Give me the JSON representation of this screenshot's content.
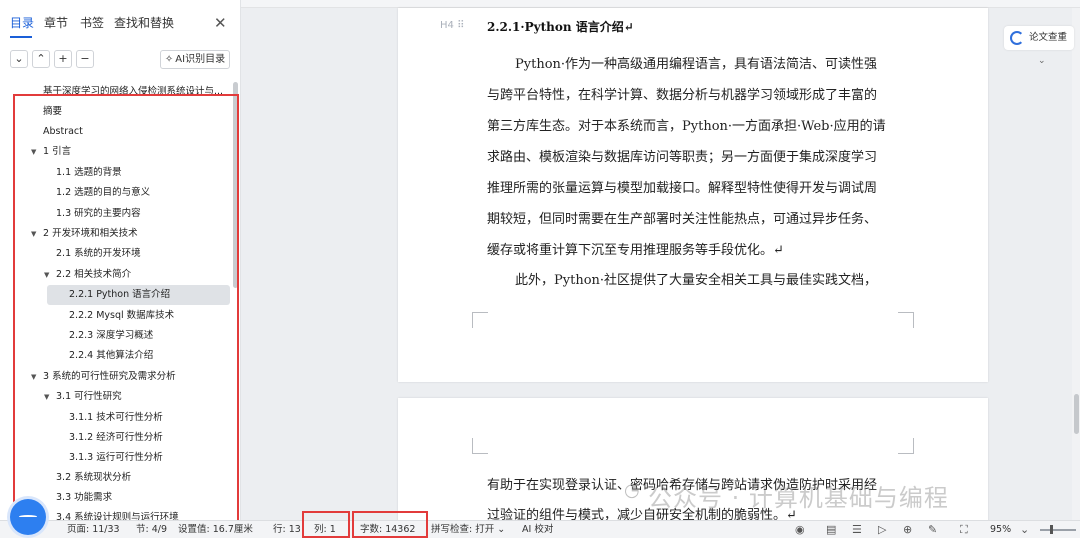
{
  "nav": {
    "tabs": [
      {
        "label": "目录"
      },
      {
        "label": "章节"
      },
      {
        "label": "书签"
      },
      {
        "label": "查找和替换"
      }
    ],
    "close_symbol": "✕",
    "tools": {
      "collapse": "⌄",
      "expand": "⌃",
      "add": "+",
      "remove": "−",
      "ai_toc_label": "AI识别目录"
    },
    "toc": [
      {
        "label": "基于深度学习的网络入侵检测系统设计与..."
      },
      {
        "label": "摘要"
      },
      {
        "label": "Abstract"
      },
      {
        "label": "1  引言"
      },
      {
        "label": "1.1 选题的背景"
      },
      {
        "label": "1.2 选题的目的与意义"
      },
      {
        "label": "1.3 研究的主要内容"
      },
      {
        "label": "2  开发环境和相关技术"
      },
      {
        "label": "2.1 系统的开发环境"
      },
      {
        "label": "2.2 相关技术简介"
      },
      {
        "label": "2.2.1 Python 语言介绍"
      },
      {
        "label": "2.2.2 Mysql 数据库技术"
      },
      {
        "label": "2.2.3  深度学习概述"
      },
      {
        "label": "2.2.4  其他算法介绍"
      },
      {
        "label": "3 系统的可行性研究及需求分析"
      },
      {
        "label": "3.1 可行性研究"
      },
      {
        "label": "3.1.1 技术可行性分析"
      },
      {
        "label": "3.1.2 经济可行性分析"
      },
      {
        "label": "3.1.3 运行可行性分析"
      },
      {
        "label": "3.2  系统现状分析"
      },
      {
        "label": "3.3 功能需求"
      },
      {
        "label": "3.4 系统设计规则与运行环境"
      }
    ]
  },
  "document": {
    "heading_tag": "H4",
    "heading": "2.2.1·Python 语言介绍↵",
    "page1_lines": [
      "Python·作为一种高级通用编程语言，具有语法简洁、可读性强",
      "与跨平台特性，在科学计算、数据分析与机器学习领域形成了丰富的",
      "第三方库生态。对于本系统而言，Python·一方面承担·Web·应用的请",
      "求路由、模板渲染与数据库访问等职责；另一方面便于集成深度学习",
      "推理所需的张量运算与模型加载接口。解释型特性使得开发与调试周",
      "期较短，但同时需要在生产部署时关注性能热点，可通过异步任务、",
      "缓存或将重计算下沉至专用推理服务等手段优化。↵",
      "此外，Python·社区提供了大量安全相关工具与最佳实践文档，"
    ],
    "page2_lines": [
      "有助于在实现登录认证、密码哈希存储与跨站请求伪造防护时采用经",
      "过验证的组件与模式，减少自研安全机制的脆弱性。↵"
    ],
    "watermark": "公众号 · 计算机基础与编程"
  },
  "side_panel": {
    "lunwen_label": "论文查重"
  },
  "status_bar": {
    "page": "页面: 11/33",
    "section": "节: 4/9",
    "setting": "设置值: 16.7厘米",
    "row": "行: 13",
    "col": "列: 1",
    "words": "字数: 14362",
    "spell": "拼写检查: 打开 ⌄",
    "ai_check": "AI 校对",
    "zoom": "95%"
  },
  "colors": {
    "accent": "#1a5fd8",
    "highlight_box": "#e23b3b",
    "selected_toc_bg": "#dfe2e6"
  }
}
